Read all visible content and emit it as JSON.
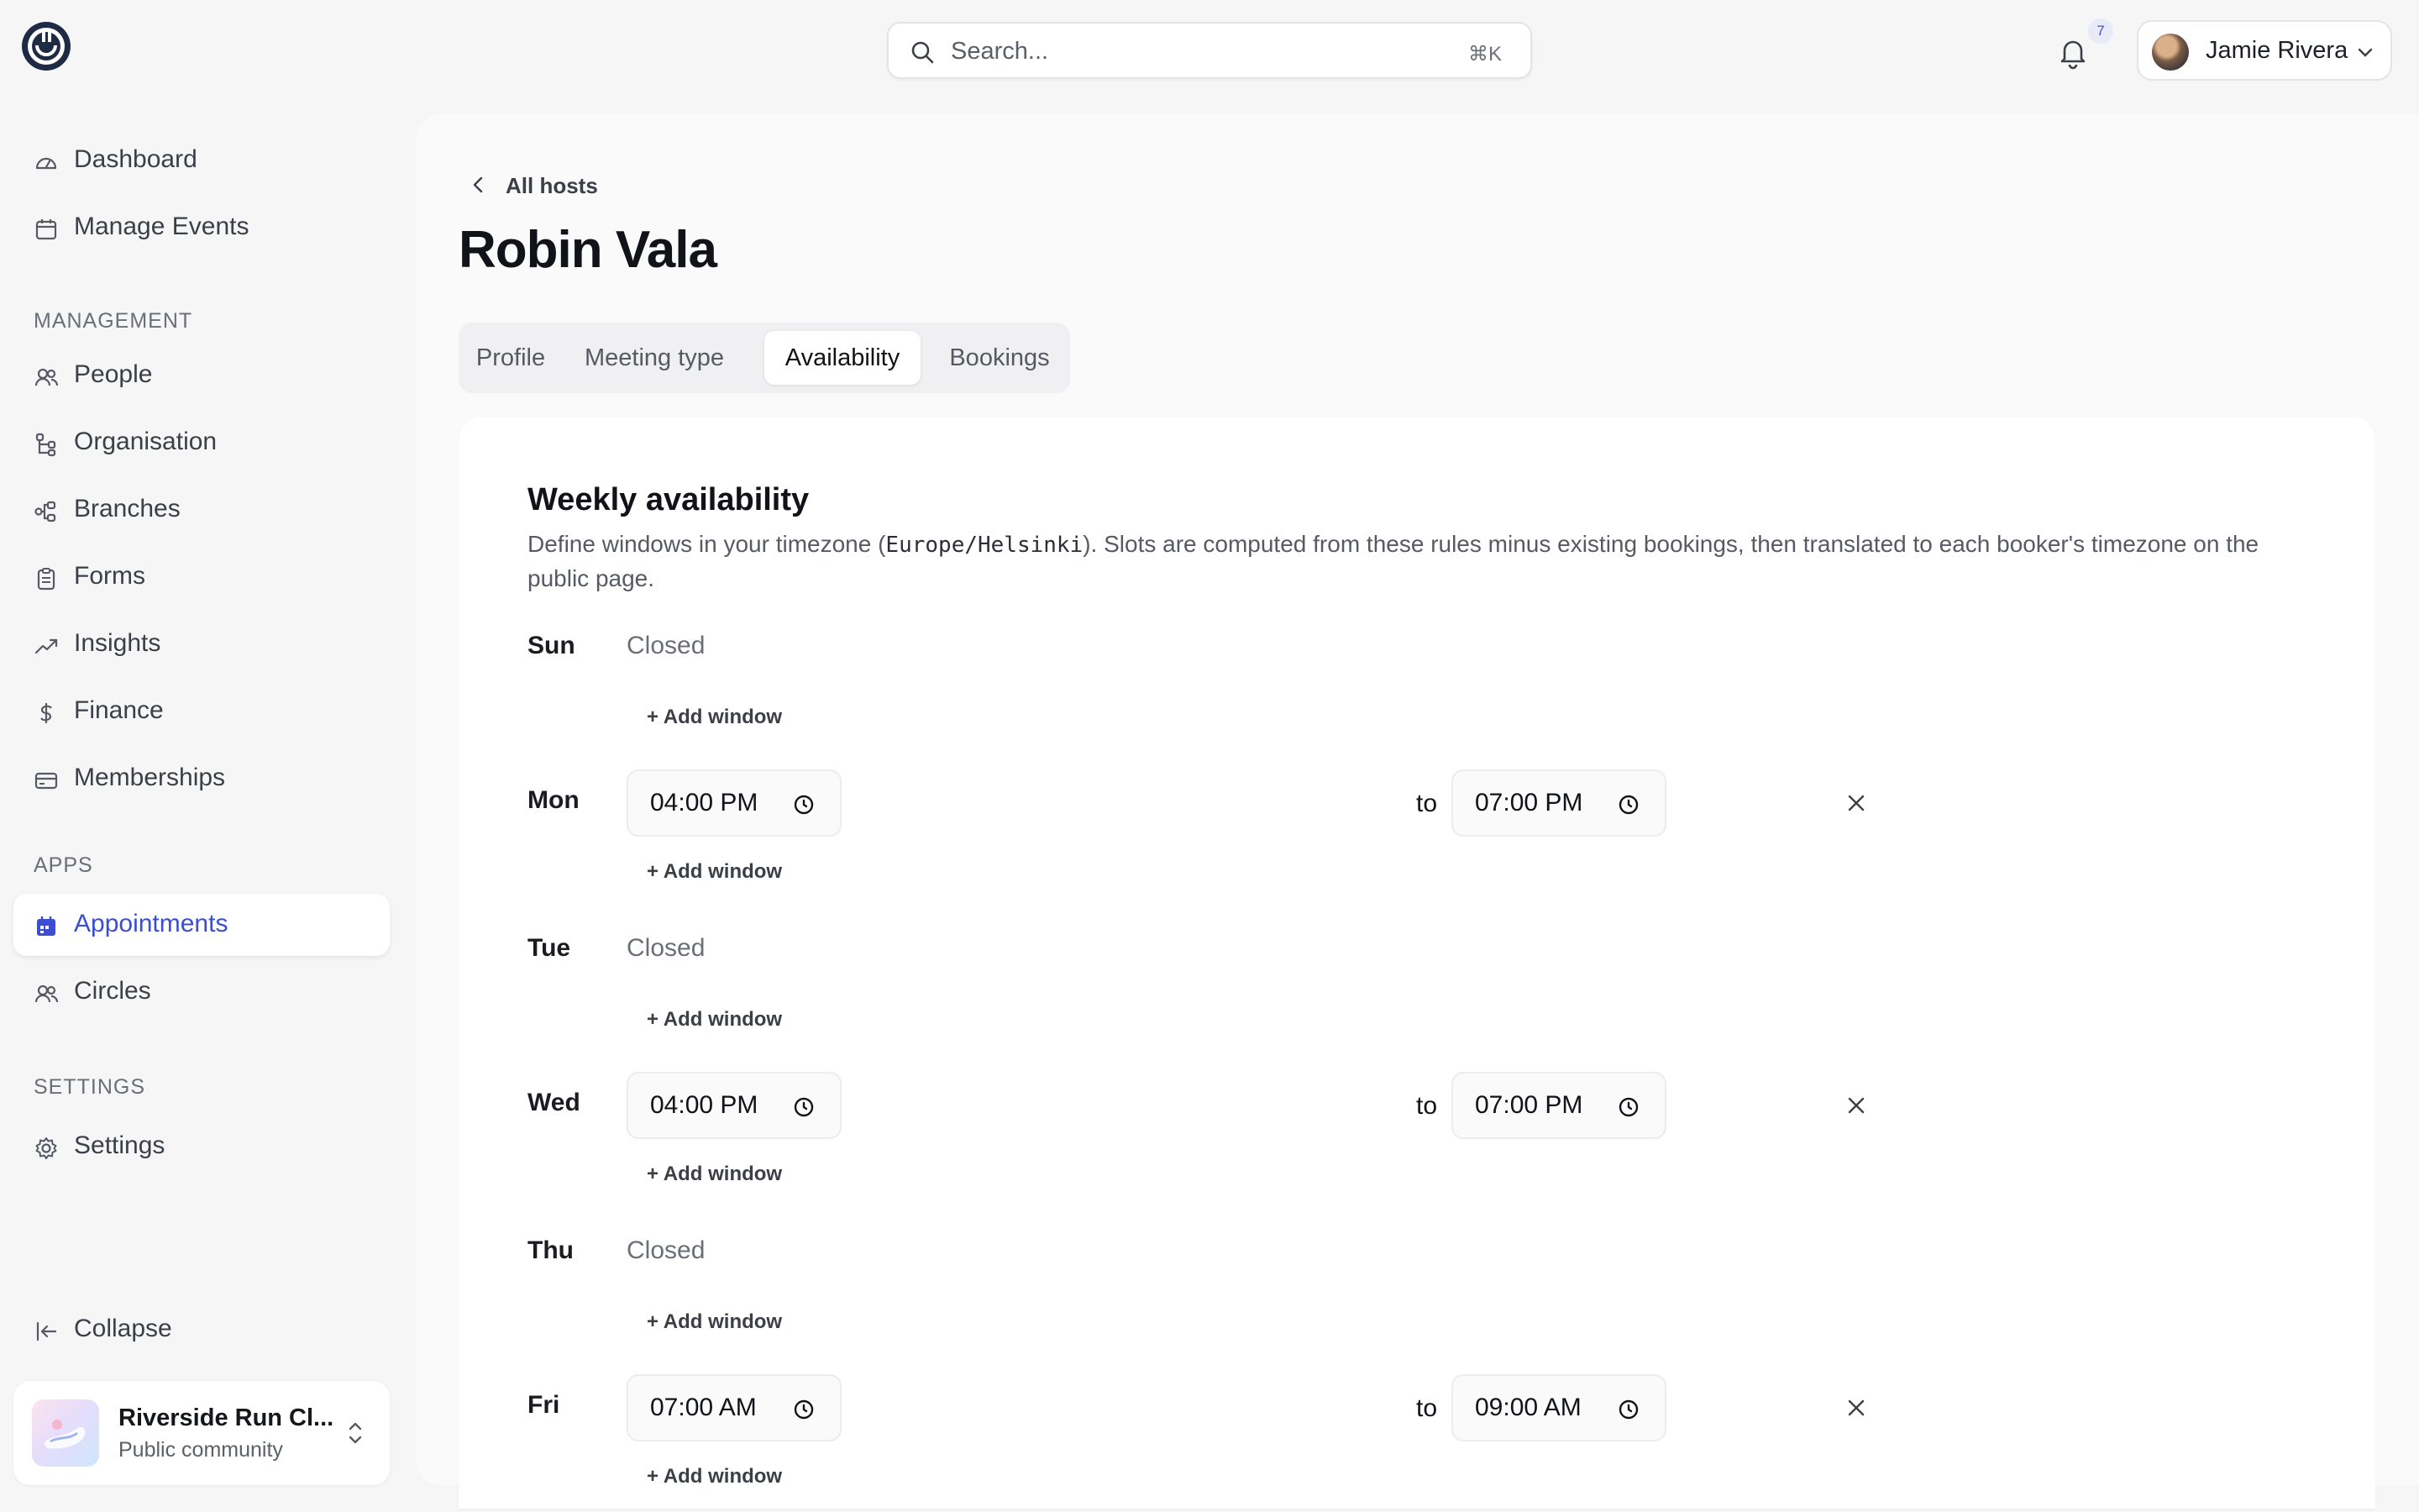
{
  "header": {
    "search_placeholder": "Search...",
    "search_shortcut": "⌘K",
    "notification_count": "7",
    "user_name": "Jamie Rivera"
  },
  "sidebar": {
    "top_items": [
      {
        "label": "Dashboard",
        "icon": "gauge-icon"
      },
      {
        "label": "Manage Events",
        "icon": "calendar-icon"
      }
    ],
    "sections": {
      "management": "MANAGEMENT",
      "apps": "APPS",
      "settings": "SETTINGS"
    },
    "management_items": [
      {
        "label": "People",
        "icon": "users-icon"
      },
      {
        "label": "Organisation",
        "icon": "org-tree-icon"
      },
      {
        "label": "Branches",
        "icon": "branches-icon"
      },
      {
        "label": "Forms",
        "icon": "clipboard-icon"
      },
      {
        "label": "Insights",
        "icon": "trend-icon"
      },
      {
        "label": "Finance",
        "icon": "dollar-icon"
      },
      {
        "label": "Memberships",
        "icon": "card-icon"
      }
    ],
    "apps_items": [
      {
        "label": "Appointments",
        "icon": "calendar-icon",
        "active": true
      },
      {
        "label": "Circles",
        "icon": "users-icon"
      }
    ],
    "settings_items": [
      {
        "label": "Settings",
        "icon": "gear-icon"
      }
    ],
    "collapse_label": "Collapse",
    "org": {
      "name": "Riverside Run Cl...",
      "subtitle": "Public community"
    },
    "active_color": "#3b4ed1"
  },
  "main": {
    "breadcrumb": "All hosts",
    "title": "Robin Vala",
    "tabs": [
      {
        "label": "Profile"
      },
      {
        "label": "Meeting type"
      },
      {
        "label": "Availability",
        "active": true
      },
      {
        "label": "Bookings"
      }
    ],
    "card": {
      "title": "Weekly availability",
      "desc_before": "Define windows in your timezone (",
      "desc_tz": "Europe/Helsinki",
      "desc_after": "). Slots are computed from these rules minus existing bookings, then translated to each booker's timezone on the public page.",
      "to_label": "to",
      "closed_label": "Closed",
      "add_window_label": "+ Add window",
      "days": [
        {
          "day": "Sun",
          "closed": true
        },
        {
          "day": "Mon",
          "closed": false,
          "from": "04:00 PM",
          "to": "07:00 PM"
        },
        {
          "day": "Tue",
          "closed": true
        },
        {
          "day": "Wed",
          "closed": false,
          "from": "04:00 PM",
          "to": "07:00 PM"
        },
        {
          "day": "Thu",
          "closed": true
        },
        {
          "day": "Fri",
          "closed": false,
          "from": "07:00 AM",
          "to": "09:00 AM"
        }
      ]
    }
  }
}
